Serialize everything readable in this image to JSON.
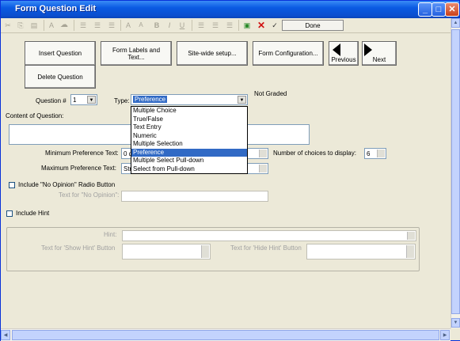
{
  "window": {
    "title": "Form Question Edit"
  },
  "toolbar": {
    "icons": [
      "cut-icon",
      "copy-icon",
      "paste-icon",
      "font-icon",
      "color-icon",
      "bullet-list-icon",
      "numbered-list-icon",
      "indent-icon",
      "font-larger-icon",
      "font-smaller-icon",
      "bold-icon",
      "italic-icon",
      "underline-icon",
      "align-left-icon",
      "align-center-icon",
      "align-right-icon",
      "insert-icon",
      "delete-icon",
      "spell-check-icon"
    ],
    "glyphs": {
      "font": "A",
      "bold": "B",
      "italic": "I",
      "underline": "U",
      "larger": "A",
      "smaller": "A"
    },
    "done_label": "Done"
  },
  "actions": {
    "insert_question": "Insert Question",
    "form_labels": "Form Labels and Text...",
    "site_wide": "Site-wide setup...",
    "form_config": "Form Configuration...",
    "previous": "Previous",
    "next": "Next",
    "delete_question": "Delete Question"
  },
  "question": {
    "number_label": "Question #",
    "number_value": "1",
    "type_label": "Type:",
    "type_value": "Preference",
    "grading": "Not Graded",
    "content_label": "Content of Question:"
  },
  "type_options": [
    "Multiple Choice",
    "True/False",
    "Text Entry",
    "Numeric",
    "Multiple Selection",
    "Preference",
    "Multiple Select Pull-down",
    "Select from Pull-down"
  ],
  "type_selected": "Preference",
  "preference": {
    "min_label": "Minimum Preference Text:",
    "min_value": "0 d",
    "max_label": "Maximum Preference Text:",
    "max_value": "Str",
    "choices_label": "Number of choices to display:",
    "choices_value": "6"
  },
  "no_opinion": {
    "checkbox_label": "Include \"No Opinion\" Radio Button",
    "text_label": "Text for \"No Opinion\":"
  },
  "hint": {
    "checkbox_label": "Include Hint",
    "hint_label": "Hint:",
    "show_label": "Text for 'Show Hint' Button",
    "hide_label": "Text for 'Hide Hint' Button"
  }
}
